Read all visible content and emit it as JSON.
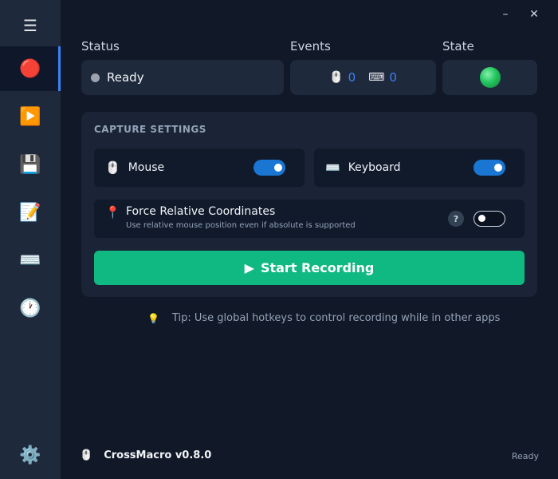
{
  "window": {
    "minimize_glyph": "–",
    "close_glyph": "✕"
  },
  "sidebar": {
    "menu_glyph": "☰",
    "items": [
      {
        "name": "record",
        "glyph": "🔴",
        "active": true
      },
      {
        "name": "play",
        "glyph": "▶️"
      },
      {
        "name": "save",
        "glyph": "💾"
      },
      {
        "name": "editor",
        "glyph": "📝"
      },
      {
        "name": "hotkeys",
        "glyph": "⌨️"
      },
      {
        "name": "schedule",
        "glyph": "🕐"
      }
    ],
    "settings_glyph": "⚙️"
  },
  "status": {
    "label": "Status",
    "value": "Ready",
    "dot_color": "#9ca3af"
  },
  "events": {
    "label": "Events",
    "mouse_glyph": "🖱️",
    "mouse_count": "0",
    "keyboard_glyph": "⌨",
    "keyboard_count": "0",
    "count_color": "#3b82f6"
  },
  "state": {
    "label": "State",
    "indicator_color": "#22c55e"
  },
  "capture_settings": {
    "title": "CAPTURE SETTINGS",
    "mouse": {
      "glyph": "🖱️",
      "label": "Mouse",
      "enabled": true
    },
    "keyboard": {
      "glyph": "⌨️",
      "label": "Keyboard",
      "enabled": true
    },
    "force_relative": {
      "glyph": "📍",
      "title": "Force Relative Coordinates",
      "description": "Use relative mouse position even if absolute is supported",
      "help_glyph": "?",
      "enabled": false
    },
    "record_button": {
      "glyph": "▶",
      "label": "Start Recording",
      "color": "#10b981"
    }
  },
  "tip": {
    "glyph": "💡",
    "text": "Tip: Use global hotkeys to control recording while in other apps"
  },
  "footer": {
    "app_glyph": "🖱️",
    "app_name": "CrossMacro v0.8.0",
    "status": "Ready"
  },
  "colors": {
    "accent": "#1976d2",
    "background": "#111827",
    "sidebar": "#1e293b"
  }
}
